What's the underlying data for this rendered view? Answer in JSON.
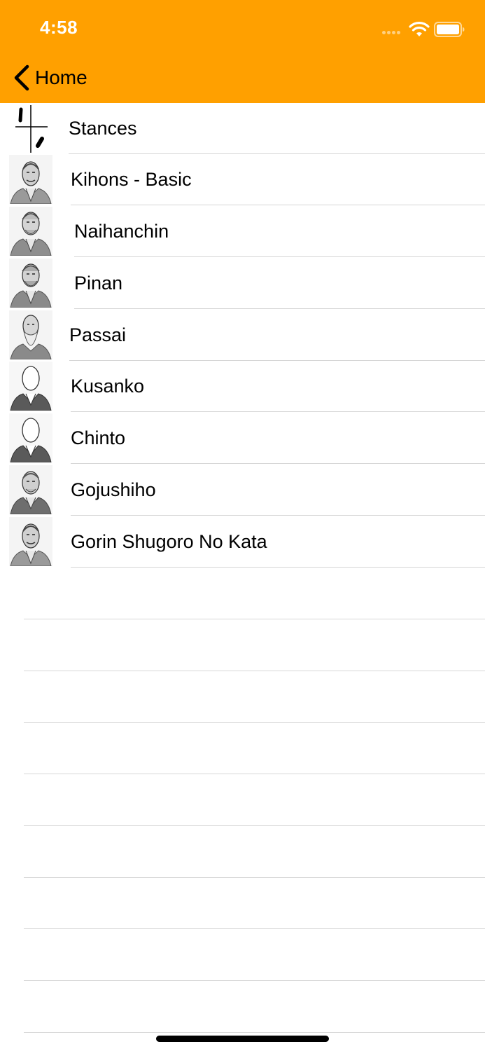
{
  "status_bar": {
    "time": "4:58"
  },
  "nav": {
    "back_label": "Home",
    "bar_color": "#FFA000"
  },
  "list": {
    "items": [
      {
        "label": "Stances",
        "icon": "stance-diagram-icon"
      },
      {
        "label": "Kihons - Basic",
        "icon": "master-portrait-icon"
      },
      {
        "label": "Naihanchin",
        "icon": "master-portrait-icon"
      },
      {
        "label": "Pinan",
        "icon": "master-portrait-icon"
      },
      {
        "label": "Passai",
        "icon": "master-portrait-icon"
      },
      {
        "label": "Kusanko",
        "icon": "blank-face-portrait-icon"
      },
      {
        "label": "Chinto",
        "icon": "blank-face-portrait-icon"
      },
      {
        "label": "Gojushiho",
        "icon": "master-portrait-icon"
      },
      {
        "label": "Gorin Shugoro No Kata",
        "icon": "master-portrait-icon"
      }
    ]
  }
}
